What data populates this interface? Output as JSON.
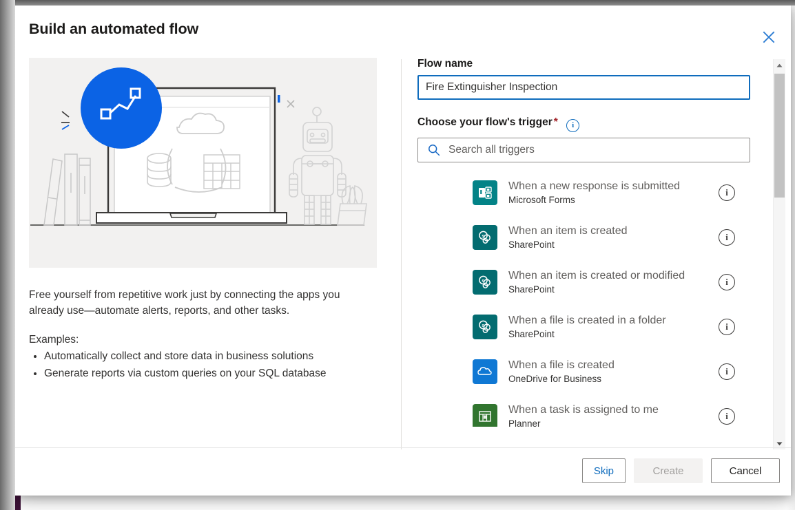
{
  "dialog": {
    "title": "Build an automated flow",
    "close_icon": "close-icon"
  },
  "left_panel": {
    "illustration_alt": "laptop-automation-illustration",
    "description": "Free yourself from repetitive work just by connecting the apps you already use—automate alerts, reports, and other tasks.",
    "examples_label": "Examples:",
    "examples": [
      "Automatically collect and store data in business solutions",
      "Generate reports via custom queries on your SQL database"
    ]
  },
  "right_panel": {
    "flow_name_label": "Flow name",
    "flow_name_value": "Fire Extinguisher Inspection",
    "flow_name_placeholder": "Flow name",
    "trigger_label": "Choose your flow's trigger",
    "required_mark": "*",
    "info_glyph": "i",
    "search_placeholder": "Search all triggers",
    "search_value": "",
    "search_icon": "search-icon",
    "triggers": [
      {
        "title": "When a new response is submitted",
        "connector": "Microsoft Forms",
        "icon": "microsoft-forms-icon",
        "color": "#038387"
      },
      {
        "title": "When an item is created",
        "connector": "SharePoint",
        "icon": "sharepoint-icon",
        "color": "#036c70"
      },
      {
        "title": "When an item is created or modified",
        "connector": "SharePoint",
        "icon": "sharepoint-icon",
        "color": "#036c70"
      },
      {
        "title": "When a file is created in a folder",
        "connector": "SharePoint",
        "icon": "sharepoint-icon",
        "color": "#036c70"
      },
      {
        "title": "When a file is created",
        "connector": "OneDrive for Business",
        "icon": "onedrive-icon",
        "color": "#0f78d4"
      },
      {
        "title": "When a task is assigned to me",
        "connector": "Planner",
        "icon": "planner-icon",
        "color": "#31752f"
      }
    ]
  },
  "scrollbar": {
    "up_arrow": "chevron-up-icon",
    "down_arrow": "chevron-down-icon"
  },
  "footer": {
    "skip_label": "Skip",
    "create_label": "Create",
    "cancel_label": "Cancel"
  },
  "colors": {
    "accent_blue": "#0f6cbd",
    "required_red": "#a4262c",
    "illustration_bg": "#f2f1f0",
    "badge_blue": "#0b63e5"
  }
}
